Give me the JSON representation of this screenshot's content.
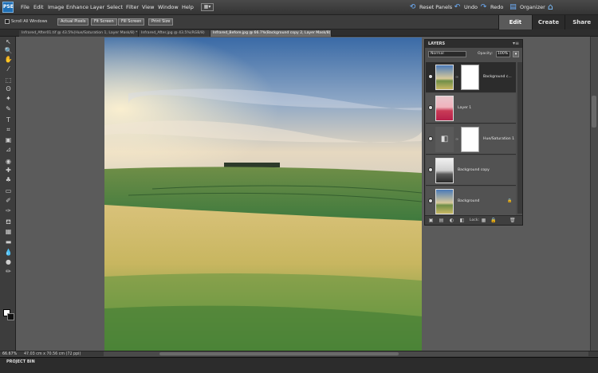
{
  "app": {
    "logo_text": "PSE"
  },
  "menu": [
    "File",
    "Edit",
    "Image",
    "Enhance",
    "Layer",
    "Select",
    "Filter",
    "View",
    "Window",
    "Help"
  ],
  "top_actions": {
    "reset_panels": "Reset Panels",
    "undo": "Undo",
    "redo": "Redo",
    "organizer": "Organizer"
  },
  "mode_tabs": [
    "Edit",
    "Create",
    "Share"
  ],
  "options": {
    "scroll_all": "Scroll All Windows",
    "buttons": [
      "Actual Pixels",
      "Fit Screen",
      "Fill Screen",
      "Print Size"
    ]
  },
  "doc_tabs": [
    "Infrared_After01.tif @ 43.5%(Hue/Saturation 1, Layer Mask/8) *",
    "Infrared_After.jpg @ 43.5%(RGB/8)",
    "Infrared_Before.jpg @ 66.7%(Background copy 2, Layer Mask/8) *"
  ],
  "layers_panel": {
    "title": "LAYERS",
    "blend_mode": "Normal",
    "opacity_label": "Opacity:",
    "opacity_value": "100%",
    "lock_label": "Lock:",
    "layers": [
      {
        "name": "Background c...",
        "has_mask": true,
        "active": true
      },
      {
        "name": "Layer 1",
        "has_mask": false,
        "active": false
      },
      {
        "name": "Hue/Saturation 1",
        "has_mask": true,
        "active": false
      },
      {
        "name": "Background copy",
        "has_mask": false,
        "active": false
      },
      {
        "name": "Background",
        "has_mask": false,
        "active": false,
        "locked": true
      }
    ]
  },
  "status": {
    "zoom": "66.67%",
    "doc_info": "47.03 cm x 70.56 cm (72 ppi)"
  },
  "project_bin": {
    "label": "PROJECT BIN"
  },
  "colors": {
    "accent": "#6fb1ff",
    "active_layer": "#2c2c2c"
  }
}
